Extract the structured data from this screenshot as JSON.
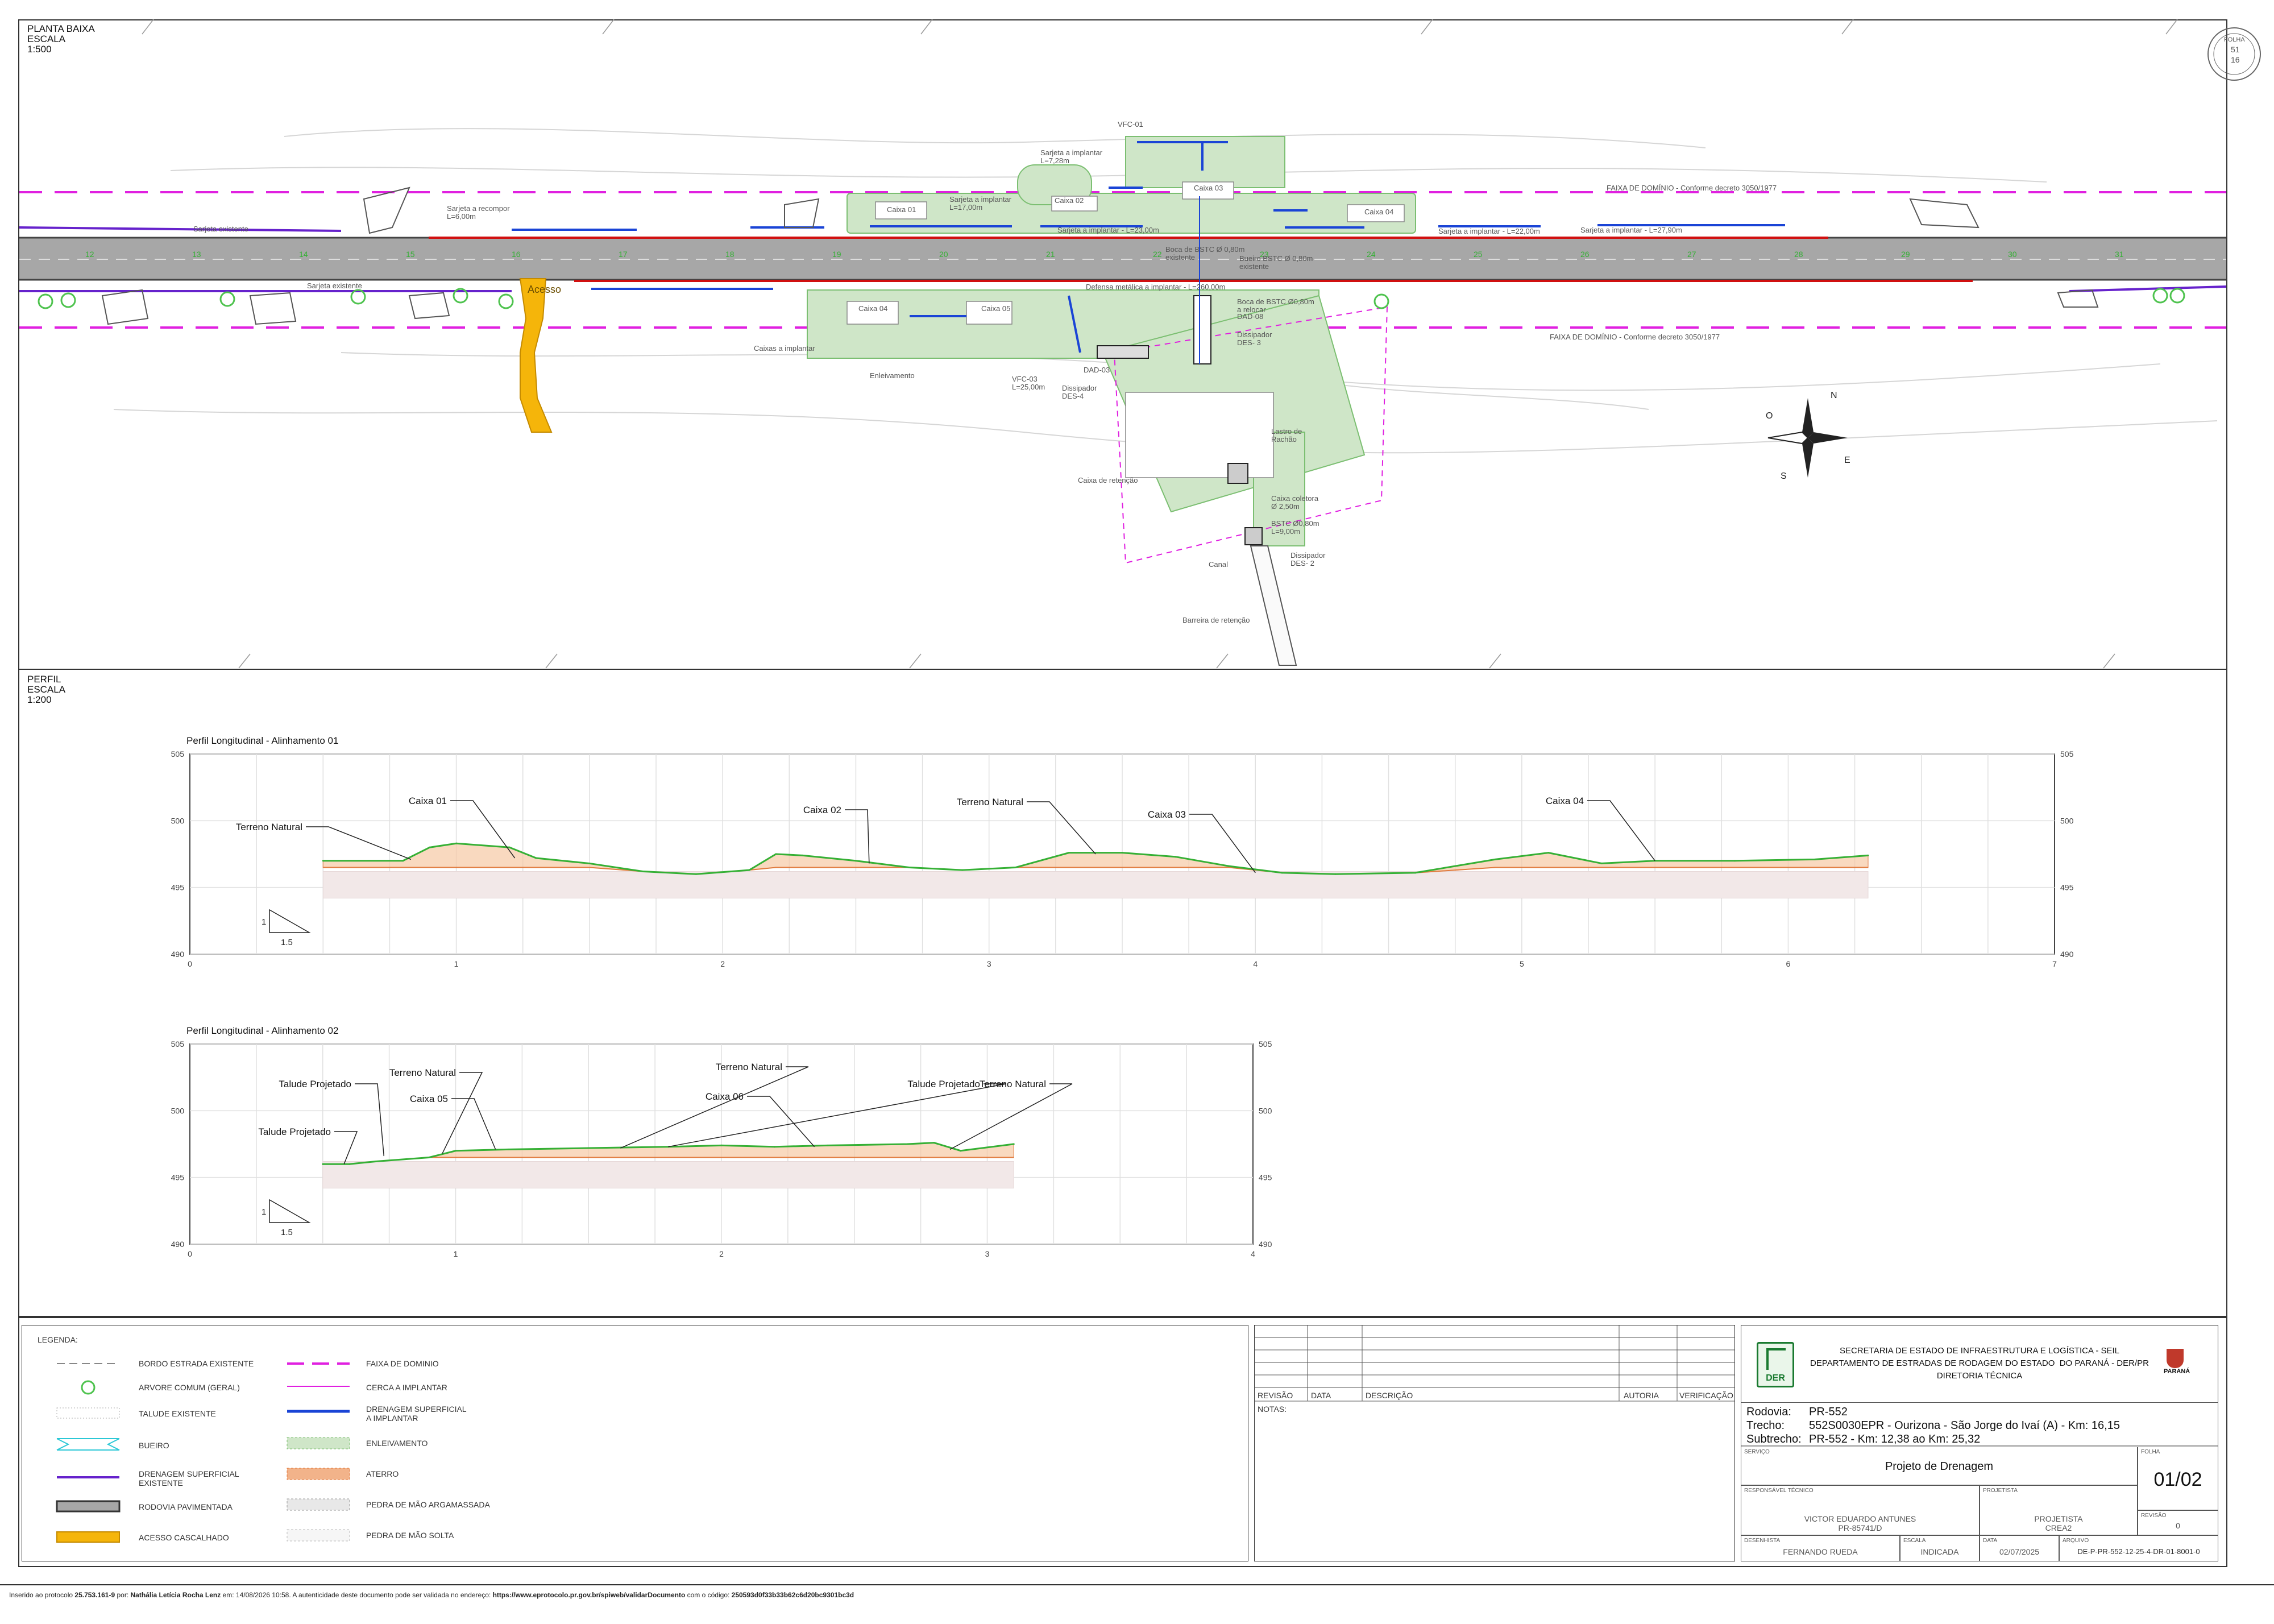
{
  "plan": {
    "title": "PLANTA BAIXA",
    "scale_label": "ESCALA",
    "scale": "1:500",
    "annotations": [
      "Sarjeta existente",
      "Sarjeta a recompor\nL=6,00m",
      "Caixa 01",
      "Sarjeta a implantar\nL=17,00m",
      "Caixa 02",
      "Caixa 03",
      "Caixa 04",
      "VFC-01",
      "Sarjeta a implantar\nL=7,28m",
      "Sarjeta a implantar - L=23,00m",
      "Sarjeta a implantar - L=22,00m",
      "Sarjeta a implantar - L=27,90m",
      "FAIXA DE DOMÍNIO - Conforme decreto 3050/1977",
      "Boca de BSTC Ø 0,80m\nexistente",
      "Defensa metálica a implantar - L=260,00m",
      "Caixa 04",
      "Caixa 05",
      "Caixas a implantar",
      "Enleivamento",
      "Bueiro BSTC Ø 0,80m\nexistente",
      "Boca de BSTC Ø0,80m\na relocar",
      "DAD-08",
      "Dissipador\nDES- 3",
      "VFC-03\nL=25,00m",
      "DAD-03",
      "Dissipador\nDES-4",
      "Lastro de\nRachão",
      "Caixa de retenção",
      "Caixa coletora\nØ 2,50m",
      "BSTC Ø0,80m\nL=9,00m",
      "Dissipador\nDES- 2",
      "Canal",
      "Barreira de retenção",
      "Acesso",
      "FAIXA DE DOMÍNIO - Conforme decreto 3050/1977",
      "Sarjeta existente"
    ]
  },
  "profile": {
    "title": "PERFIL",
    "scale_label": "ESCALA",
    "scale": "1:200",
    "chart1_title": "Perfil Longitudinal - Alinhamento 01",
    "chart2_title": "Perfil Longitudinal - Alinhamento 02",
    "slope_v": "1",
    "slope_h": "1.5"
  },
  "chart_data": [
    {
      "type": "line",
      "title": "Perfil Longitudinal - Alinhamento 01",
      "xlim": [
        0,
        7
      ],
      "ylim": [
        490,
        505
      ],
      "x_ticks": [
        "0",
        "1",
        "2",
        "3",
        "4",
        "5",
        "6",
        "7"
      ],
      "y_ticks": [
        "490",
        "495",
        "500",
        "505"
      ],
      "series": [
        {
          "x": [
            0.5,
            0.8,
            0.9,
            1.0,
            1.2,
            1.3,
            1.5,
            1.7,
            1.9,
            2.1,
            2.2,
            2.3,
            2.5,
            2.7,
            2.9,
            3.1,
            3.3,
            3.5,
            3.7,
            3.9,
            4.1,
            4.3,
            4.6,
            4.9,
            5.1,
            5.3,
            5.5,
            5.8,
            6.1,
            6.3
          ],
          "y": [
            497.0,
            497.0,
            498.0,
            498.3,
            498.0,
            497.2,
            496.8,
            496.2,
            496.0,
            496.3,
            497.5,
            497.4,
            497.0,
            496.5,
            496.3,
            496.5,
            497.6,
            497.6,
            497.3,
            496.6,
            496.1,
            496.0,
            496.1,
            497.1,
            497.6,
            496.8,
            497.0,
            497.0,
            497.1,
            497.4
          ]
        }
      ],
      "annotations": [
        "Terreno Natural",
        "Caixa 01",
        "Caixa 02",
        "Terreno Natural",
        "Caixa 03",
        "Caixa 04"
      ]
    },
    {
      "type": "line",
      "title": "Perfil Longitudinal - Alinhamento 02",
      "xlim": [
        0,
        4
      ],
      "ylim": [
        490,
        505
      ],
      "x_ticks": [
        "0",
        "1",
        "2",
        "3",
        "4"
      ],
      "y_ticks": [
        "490",
        "495",
        "500",
        "505"
      ],
      "series": [
        {
          "x": [
            0.5,
            0.6,
            0.7,
            0.9,
            1.0,
            1.2,
            1.5,
            1.8,
            2.0,
            2.2,
            2.4,
            2.7,
            2.8,
            2.9,
            3.1
          ],
          "y": [
            496.0,
            496.0,
            496.2,
            496.5,
            497.0,
            497.1,
            497.2,
            497.3,
            497.4,
            497.3,
            497.4,
            497.5,
            497.6,
            497.0,
            497.5
          ]
        }
      ],
      "annotations": [
        "Talude Projetado",
        "Terreno Natural",
        "Talude Projetado",
        "Terreno Natural",
        "Talude Projetado",
        "Caixa 05",
        "Caixa 06",
        "Terreno Natural"
      ]
    }
  ],
  "legend": {
    "title": "LEGENDA:",
    "left": [
      "BORDO ESTRADA EXISTENTE",
      "ARVORE COMUM (GERAL)",
      "TALUDE EXISTENTE",
      "BUEIRO",
      "DRENAGEM SUPERFICIAL\nEXISTENTE",
      "RODOVIA PAVIMENTADA",
      "ACESSO CASCALHADO"
    ],
    "right": [
      "FAIXA DE DOMINIO",
      "CERCA A IMPLANTAR",
      "DRENAGEM SUPERFICIAL\nA IMPLANTAR",
      "ENLEIVAMENTO",
      "ATERRO",
      "PEDRA DE MÃO ARGAMASSADA",
      "PEDRA DE MÃO SOLTA"
    ]
  },
  "revision_table": {
    "headers": [
      "REVISÃO",
      "DATA",
      "DESCRIÇÃO",
      "AUTORIA",
      "VERIFICAÇÃO"
    ],
    "notes_label": "NOTAS:"
  },
  "title_block": {
    "org_line1": "SECRETARIA DE ESTADO DE INFRAESTRUTURA E LOGÍSTICA - SEIL",
    "org_line2": "DEPARTAMENTO DE ESTRADAS DE RODAGEM DO ESTADO  DO PARANÁ - DER/PR",
    "org_line3": "DIRETORIA TÉCNICA",
    "der_logo": "DER",
    "parana_logo": "PARANÁ",
    "rodovia_label": "Rodovia:",
    "rodovia": "PR-552",
    "trecho_label": "Trecho:",
    "trecho": "552S0030EPR - Ourizona - São Jorge do Ivaí (A) - Km: 16,15",
    "subtrecho_label": "Subtrecho:",
    "subtrecho": "PR-552 - Km: 12,38 ao Km: 25,32",
    "servico_label": "SERVIÇO",
    "servico": "Projeto de Drenagem",
    "folha_label": "FOLHA",
    "folha": "01/02",
    "resp_label": "RESPONSÁVEL TÉCNICO",
    "resp_name": "VICTOR EDUARDO ANTUNES",
    "resp_crea": "PR-85741/D",
    "projetista_label": "PROJETISTA",
    "projetista": "PROJETISTA",
    "projetista_crea": "CREA2",
    "revisao_label": "REVISÃO",
    "revisao": "0",
    "desenhista_label": "DESENHISTA",
    "desenhista": "FERNANDO RUEDA",
    "escala_label": "ESCALA",
    "escala": "INDICADA",
    "data_label": "DATA",
    "data": "02/07/2025",
    "arquivo_label": "ARQUIVO",
    "arquivo": "DE-P-PR-552-12-25-4-DR-01-8001-0"
  },
  "stamp": {
    "line1": "FOLHA",
    "line2": "51",
    "line3": "16"
  },
  "footer": {
    "text_prefix": "Inserido ao protocolo ",
    "protocol": "25.753.161-9",
    "by": " por: ",
    "author": "Nathália Letícia Rocha Lenz",
    "datetime": " em: 14/08/2026 10:58. A autenticidade deste documento pode ser validada no endereço: ",
    "url": "https://www.eprotocolo.pr.gov.br/spiweb/validarDocumento",
    "code_prefix": " com o código: ",
    "code": "250593d0f33b33b62c6d20bc9301bc3d"
  },
  "colors": {
    "road": "#a7a7a7",
    "faixa": "#e020e0",
    "drain_new": "#1a44d6",
    "drain_old": "#6622cc",
    "enleiv": "#cfe6c8",
    "aterro": "#f2b38a",
    "acesso": "#f5b50a",
    "terrain": "#35b035",
    "red_line": "#d01010"
  }
}
